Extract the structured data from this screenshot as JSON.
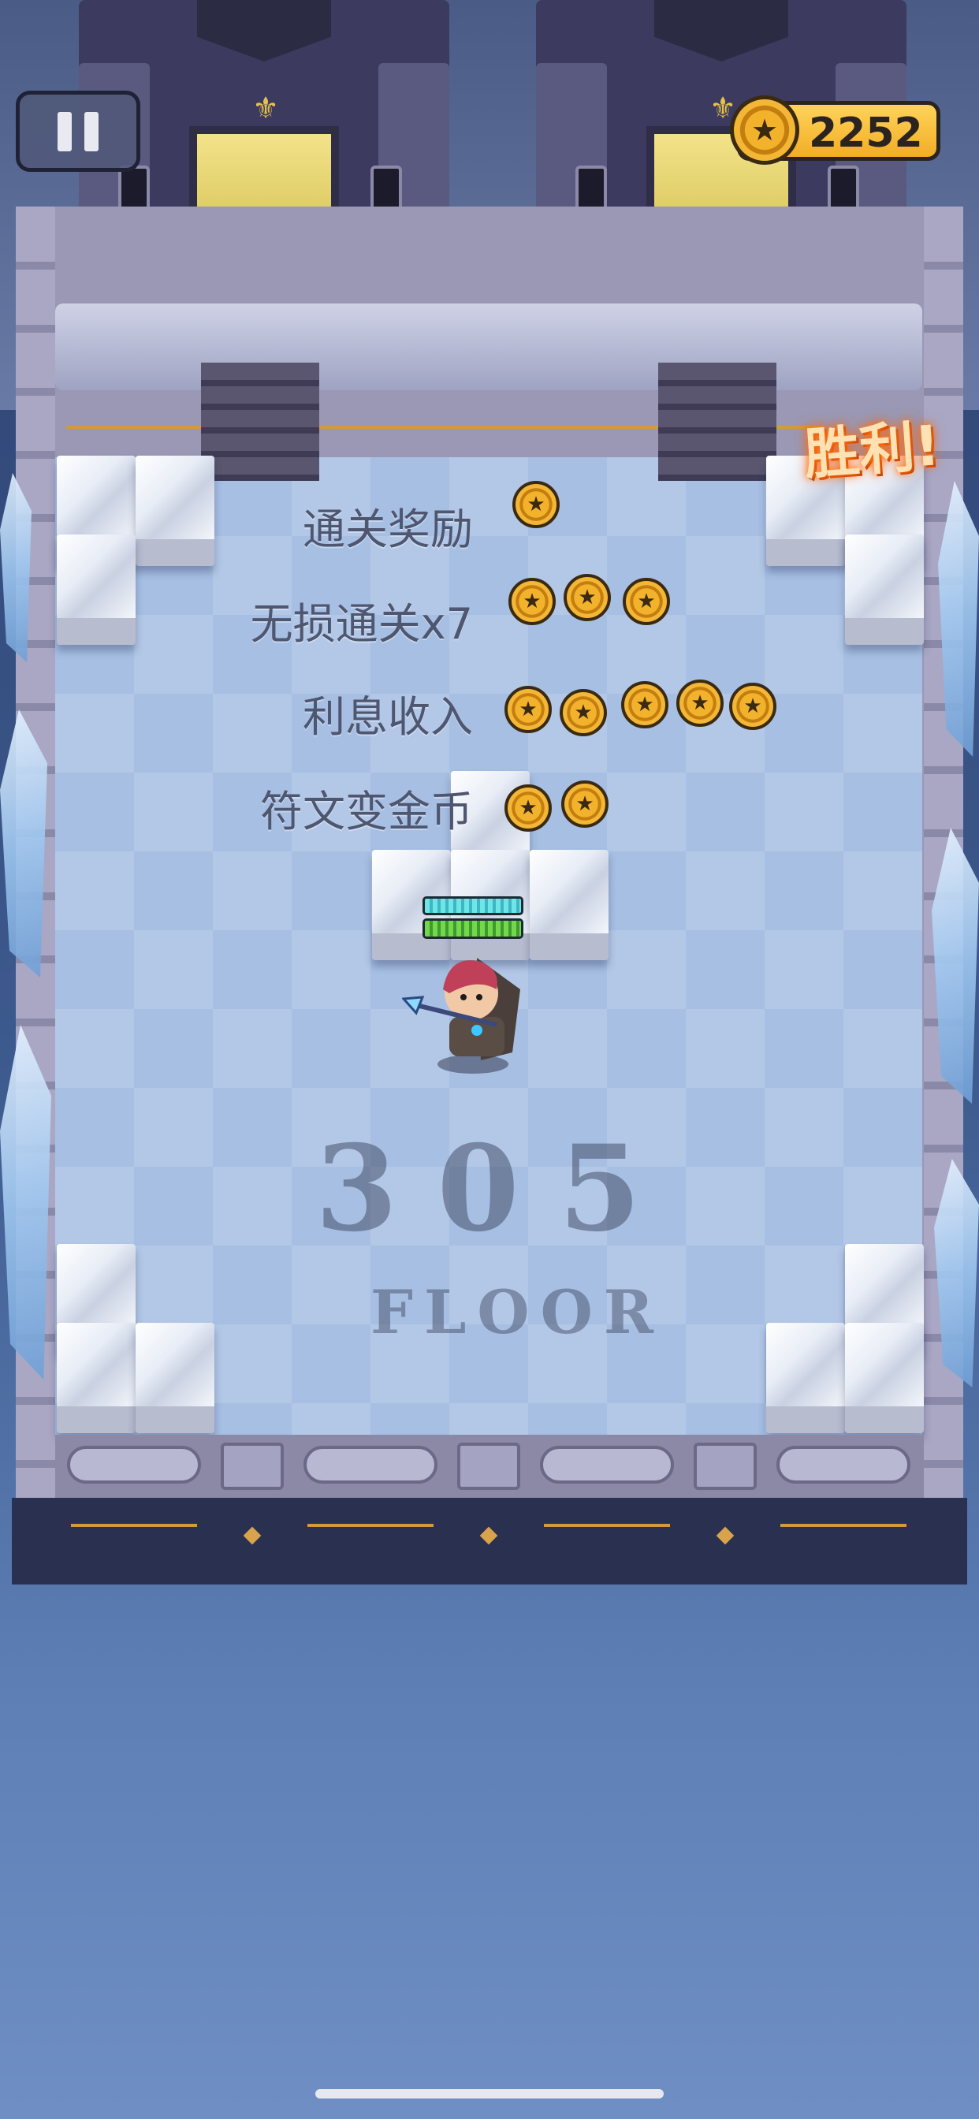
{
  "hud": {
    "coin_total": "2252",
    "coin_icon": "star-coin-icon",
    "pause_icon": "pause-icon"
  },
  "banner": {
    "victory_text": "胜利!"
  },
  "rewards": [
    {
      "label": "通关奖励",
      "coins": 1
    },
    {
      "label": "无损通关x7",
      "coins": 3
    },
    {
      "label": "利息收入",
      "coins": 5
    },
    {
      "label": "符文变金币",
      "coins": 2
    }
  ],
  "floor": {
    "number": "305",
    "label": "FLOOR"
  },
  "colors": {
    "coin": "#f2b22b",
    "victory": "#ff7a1a",
    "floor_tile": "#a6bfe3"
  }
}
